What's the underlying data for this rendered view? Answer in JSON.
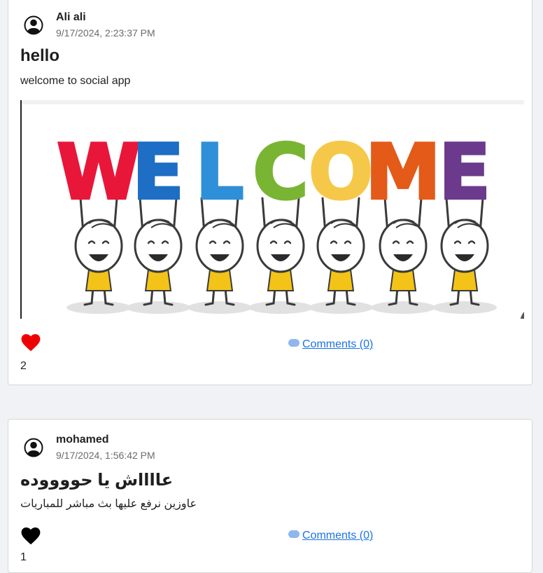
{
  "posts": [
    {
      "author": "Ali ali",
      "date": "9/17/2024, 2:23:37 PM",
      "title": "hello",
      "body": "welcome to social app",
      "image": {
        "letters": [
          "W",
          "E",
          "L",
          "C",
          "O",
          "M",
          "E"
        ],
        "letter_colors": [
          "#e8173a",
          "#1d6ec4",
          "#2f8fd8",
          "#79b433",
          "#f6c84a",
          "#e35a19",
          "#6c3a8c"
        ],
        "shirt_color": "#f3c318"
      },
      "liked": true,
      "heart_color": "#f00000",
      "likes": "2",
      "comments_label": "Comments (0)"
    },
    {
      "author": "mohamed",
      "date": "9/17/2024, 1:56:42 PM",
      "title": "عااااش يا حووووده",
      "body": "عاوزين نرفع عليها بث مباشر للمباريات",
      "liked": false,
      "heart_color": "#000000",
      "likes": "1",
      "comments_label": "Comments (0)"
    }
  ]
}
